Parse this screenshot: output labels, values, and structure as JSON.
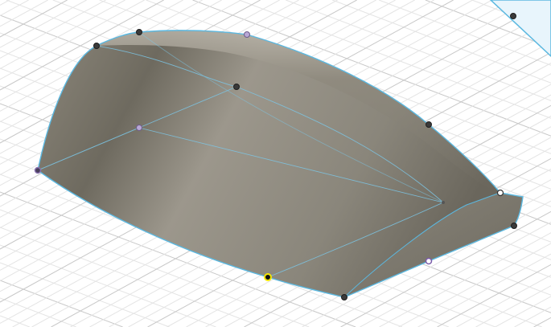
{
  "viewport": {
    "view": "3d-model-canvas",
    "colors": {
      "background": "#ffffff",
      "grid_minor": "#e4e4e4",
      "grid_major": "#c8c8c8",
      "edge": "#5bb8e0",
      "body_light": "#aaa59a",
      "body_dark": "#6f6b60",
      "selected_face": "#e8f5fc",
      "point": "#3a3a3a",
      "point_highlight": "#f5e600",
      "point_lavender": "#b9a8d6"
    }
  }
}
